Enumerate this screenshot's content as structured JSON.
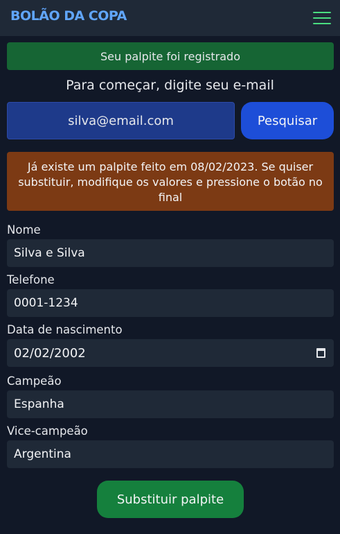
{
  "header": {
    "brand": "BOLÃO DA COPA"
  },
  "alerts": {
    "success": "Seu palpite foi registrado",
    "warning": "Já existe um palpite feito em 08/02/2023. Se quiser substituir, modifique os valores e pressione o botão no final"
  },
  "search": {
    "prompt": "Para começar, digite seu e-mail",
    "email_value": "silva@email.com",
    "button_label": "Pesquisar"
  },
  "form": {
    "name": {
      "label": "Nome",
      "value": "Silva e Silva"
    },
    "phone": {
      "label": "Telefone",
      "value": "0001-1234"
    },
    "birthdate": {
      "label": "Data de nascimento",
      "value": "02/02/2002"
    },
    "champion": {
      "label": "Campeão",
      "value": "Espanha"
    },
    "runner_up": {
      "label": "Vice-campeão",
      "value": "Argentina"
    },
    "submit_label": "Substituir palpite"
  },
  "colors": {
    "brand": "#60a5fa",
    "menu": "#4ade80",
    "success_bg": "#166534",
    "warning_bg": "#7c3a14",
    "search_btn": "#1d4ed8",
    "submit_btn": "#15803d"
  }
}
